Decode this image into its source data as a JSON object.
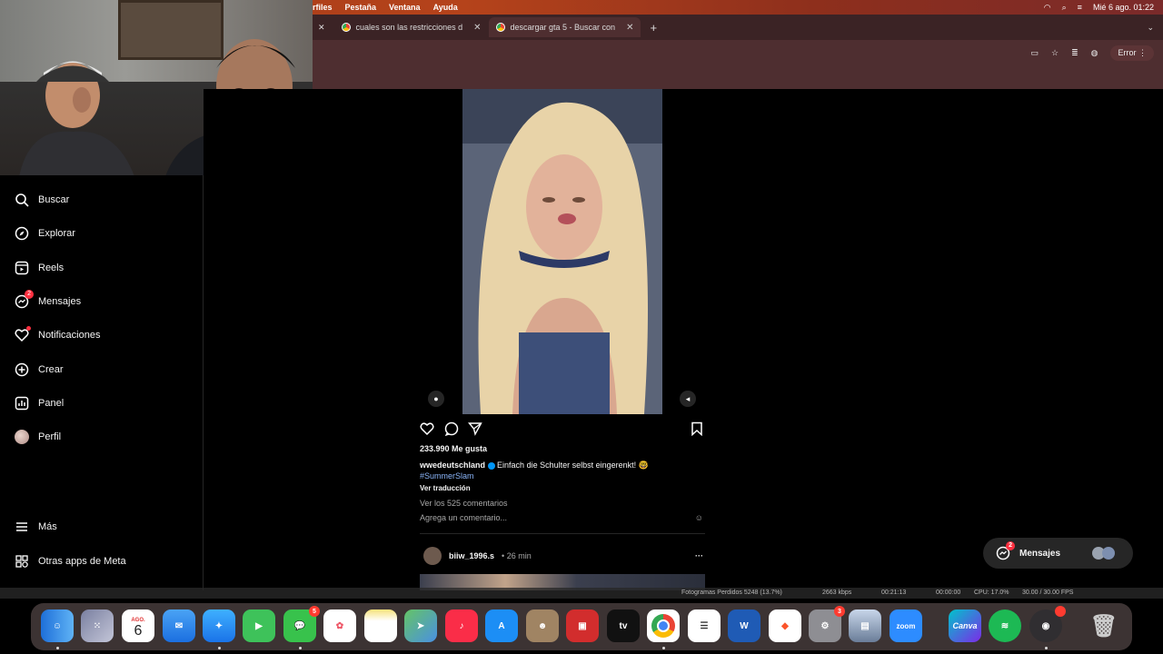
{
  "menubar": {
    "items": [
      "rfiles",
      "Pestaña",
      "Ventana",
      "Ayuda"
    ],
    "datetime": "Mié 6 ago.  01:22"
  },
  "tabs": [
    {
      "title": "cuales son las restricciones d"
    },
    {
      "title": "descargar gta 5 - Buscar con"
    }
  ],
  "toolbar": {
    "error_label": "Error"
  },
  "sidebar": {
    "items": [
      {
        "label": "Buscar",
        "icon": "search-icon"
      },
      {
        "label": "Explorar",
        "icon": "compass-icon"
      },
      {
        "label": "Reels",
        "icon": "reels-icon"
      },
      {
        "label": "Mensajes",
        "icon": "messenger-icon",
        "badge": "2"
      },
      {
        "label": "Notificaciones",
        "icon": "heart-icon"
      },
      {
        "label": "Crear",
        "icon": "plus-square-icon"
      },
      {
        "label": "Panel",
        "icon": "chart-icon"
      },
      {
        "label": "Perfil",
        "icon": "profile-avatar"
      },
      {
        "label": "Más",
        "icon": "menu-icon"
      },
      {
        "label": "Otras apps de Meta",
        "icon": "apps-icon"
      }
    ]
  },
  "post": {
    "likes": "233.990 Me gusta",
    "username": "wwedeutschland",
    "caption": "Einfach die Schulter selbst eingerenkt! 🤓",
    "hashtag": "#SummerSlam",
    "translate": "Ver traducción",
    "comments_link": "Ver los 525 comentarios",
    "add_comment": "Agrega un comentario..."
  },
  "next_post": {
    "username": "biiw_1996.s",
    "time": "• 26 min",
    "more": "···"
  },
  "messages_pill": {
    "label": "Mensajes",
    "badge": "2"
  },
  "statusbar": {
    "frames": "Fotogramas Perdidos 5248 (13.7%)",
    "bitrate": "2663 kbps",
    "rec_time": "00:21:13",
    "stream_time": "00:00:00",
    "cpu": "CPU: 17.0%",
    "fps": "30.00 / 30.00 FPS"
  },
  "dock": {
    "calendar_month": "AGO.",
    "calendar_day": "6",
    "messages_badge": "5",
    "settings_badge": "3",
    "canva_label": "Canva",
    "zoom_label": "zoom",
    "word_label": "W",
    "tv_label": "tv"
  }
}
